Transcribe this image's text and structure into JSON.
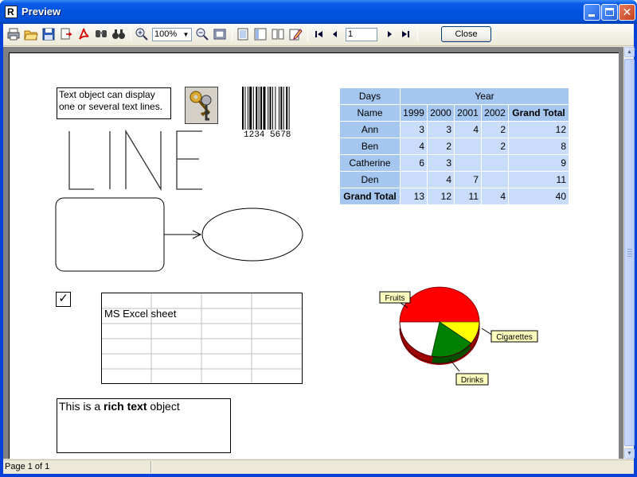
{
  "window": {
    "title": "Preview",
    "app_icon_letter": "R"
  },
  "toolbar": {
    "icons": [
      "print-icon",
      "open-icon",
      "save-icon",
      "export-icon",
      "pdf-icon",
      "find-icon",
      "binoculars-icon",
      "zoom-in-icon",
      "zoom-out-icon",
      "full-page-icon",
      "page-setup-icon",
      "outline-icon",
      "thumbnails-icon",
      "edit-icon",
      "first-page-icon",
      "prev-page-icon",
      "next-page-icon",
      "last-page-icon"
    ],
    "zoom_value": "100%",
    "page_value": "1",
    "close_label": "Close"
  },
  "status": {
    "page_text": "Page 1 of 1"
  },
  "report": {
    "text_object": "Text object can display one or several text lines.",
    "barcode_text": "1234 5678",
    "line_text": "LINE",
    "excel_label": "MS Excel sheet",
    "rich_text_prefix": "This is a ",
    "rich_text_bold": "rich text",
    "rich_text_suffix": " object",
    "checkbox_glyph": "✓",
    "crosstab": {
      "corner_top": "Days",
      "year_header": "Year",
      "name_header": "Name",
      "years": [
        "1999",
        "2000",
        "2001",
        "2002"
      ],
      "grand_total_label": "Grand Total",
      "rows": [
        {
          "name": "Ann",
          "cells": [
            "3",
            "3",
            "4",
            "2"
          ],
          "total": "12"
        },
        {
          "name": "Ben",
          "cells": [
            "4",
            "2",
            "",
            "2"
          ],
          "total": "8"
        },
        {
          "name": "Catherine",
          "cells": [
            "6",
            "3",
            "",
            ""
          ],
          "total": "9"
        },
        {
          "name": "Den",
          "cells": [
            "",
            "4",
            "7",
            ""
          ],
          "total": "11"
        }
      ],
      "totals": [
        "13",
        "12",
        "11",
        "4"
      ],
      "grand_total": "40"
    },
    "pie": {
      "labels": [
        "Fruits",
        "Cigarettes",
        "Drinks"
      ],
      "colors": [
        "#ff0000",
        "#ffff00",
        "#008000"
      ]
    }
  }
}
